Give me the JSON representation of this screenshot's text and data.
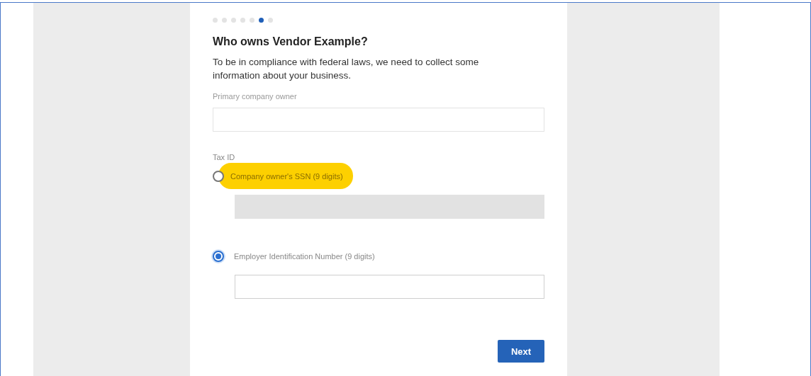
{
  "steps": [
    {
      "selected": false
    },
    {
      "selected": false
    },
    {
      "selected": false
    },
    {
      "selected": false
    },
    {
      "selected": false
    },
    {
      "selected": true
    },
    {
      "selected": false
    }
  ],
  "title": "Who owns Vendor Example?",
  "intro": "To be in compliance with federal laws, we need to collect some information about your business.",
  "owner_field": {
    "label": "Primary company owner"
  },
  "tax_id": {
    "label": "Tax ID",
    "options": [
      {
        "label": "Company owner's SSN (9 digits)",
        "selected": false,
        "highlighted": true,
        "field_disabled": true
      },
      {
        "label": "Employer Identification Number (9 digits)",
        "selected": true,
        "highlighted": false,
        "field_disabled": false
      }
    ]
  },
  "buttons": [
    {
      "label": "Next"
    }
  ]
}
